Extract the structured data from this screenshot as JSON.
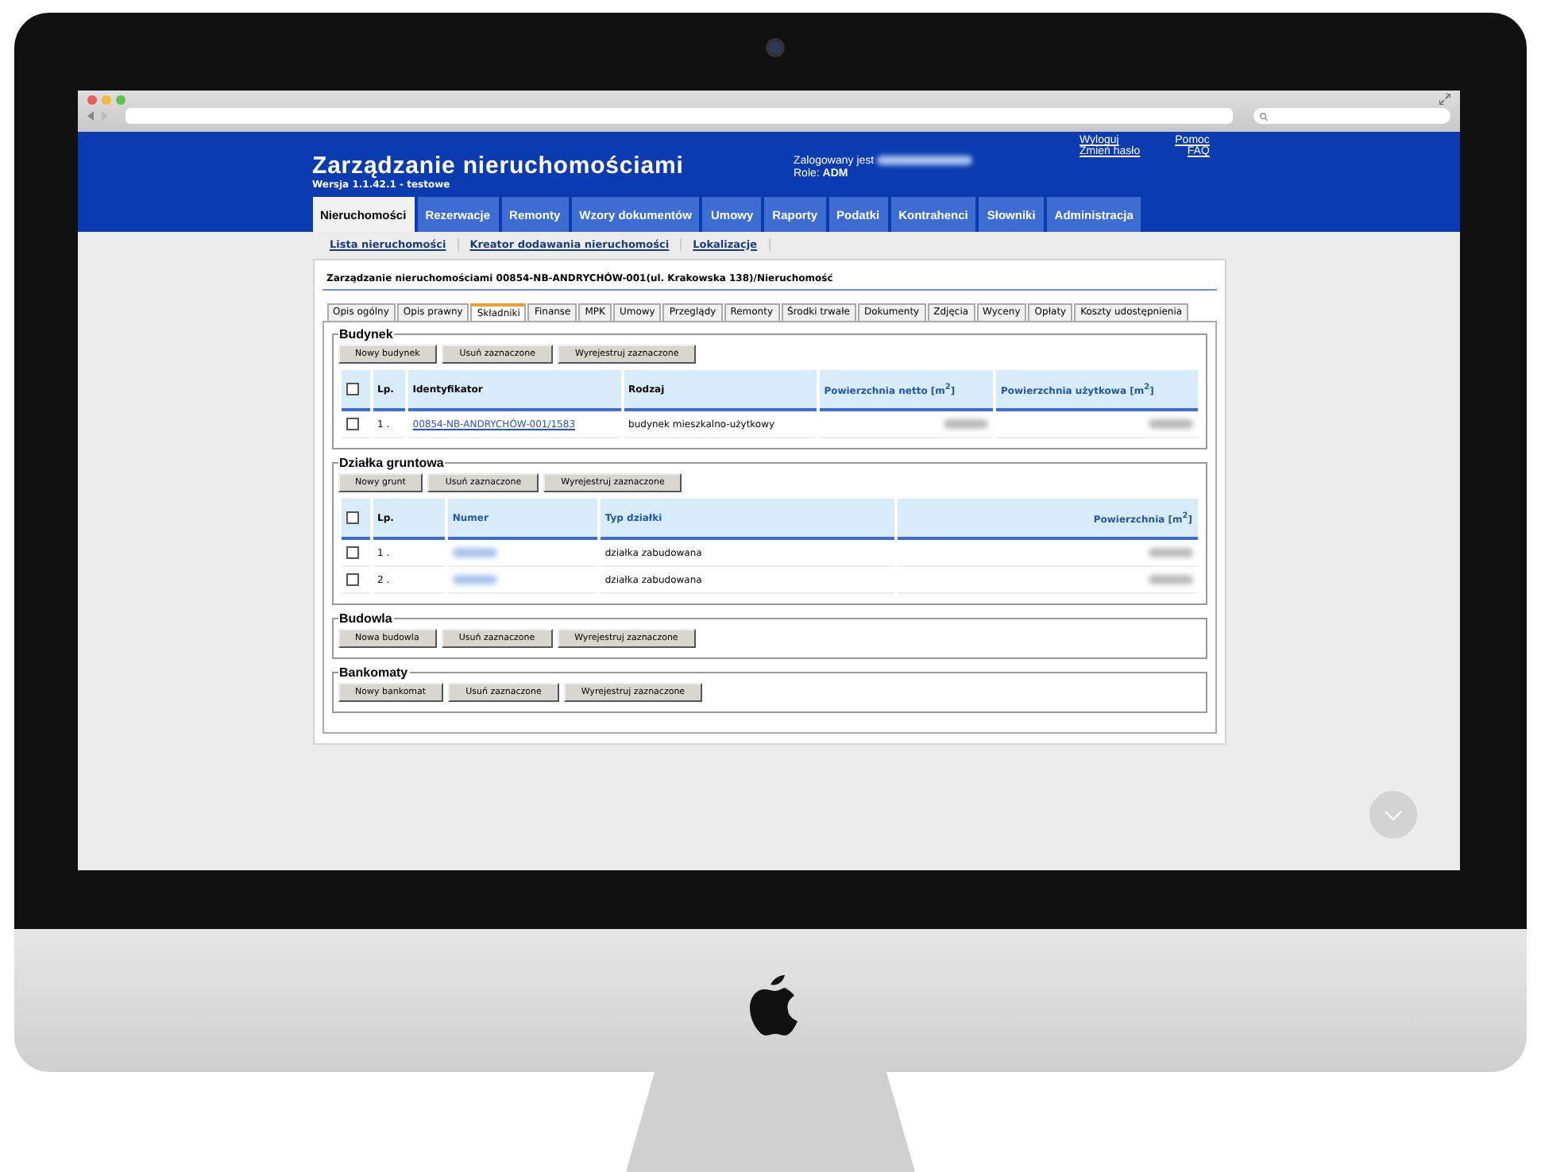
{
  "header": {
    "title": "Zarządzanie nieruchomościami",
    "version": "Wersja 1.1.42.1 - testowe",
    "user_label": "Zalogowany jest",
    "role_label": "Role:",
    "role": "ADM",
    "links": [
      "Wyloguj",
      "Pomoc",
      "Zmień hasło",
      "FAQ"
    ]
  },
  "nav_tabs": [
    {
      "label": "Nieruchomości",
      "selected": true
    },
    {
      "label": "Rezerwacje",
      "selected": false
    },
    {
      "label": "Remonty",
      "selected": false
    },
    {
      "label": "Wzory dokumentów",
      "selected": false
    },
    {
      "label": "Umowy",
      "selected": false
    },
    {
      "label": "Raporty",
      "selected": false
    },
    {
      "label": "Podatki",
      "selected": false
    },
    {
      "label": "Kontrahenci",
      "selected": false
    },
    {
      "label": "Słowniki",
      "selected": false
    },
    {
      "label": "Administracja",
      "selected": false
    }
  ],
  "subnav": [
    "Lista nieruchomości",
    "Kreator dodawania nieruchomości",
    "Lokalizacje"
  ],
  "breadcrumb": "Zarządzanie nieruchomościami 00854-NB-ANDRYCHÓW-001(ul. Krakowska 138)/Nieruchomość",
  "detail_tabs": [
    {
      "label": "Opis ogólny",
      "selected": false
    },
    {
      "label": "Opis prawny",
      "selected": false
    },
    {
      "label": "Składniki",
      "selected": true
    },
    {
      "label": "Finanse",
      "selected": false
    },
    {
      "label": "MPK",
      "selected": false
    },
    {
      "label": "Umowy",
      "selected": false
    },
    {
      "label": "Przeglądy",
      "selected": false
    },
    {
      "label": "Remonty",
      "selected": false
    },
    {
      "label": "Środki trwałe",
      "selected": false
    },
    {
      "label": "Dokumenty",
      "selected": false
    },
    {
      "label": "Zdjęcia",
      "selected": false
    },
    {
      "label": "Wyceny",
      "selected": false
    },
    {
      "label": "Opłaty",
      "selected": false
    },
    {
      "label": "Koszty udostępnienia",
      "selected": false
    }
  ],
  "sections": [
    {
      "title": "Budynek",
      "buttons": [
        "Nowy budynek",
        "Usuń zaznaczone",
        "Wyrejestruj zaznaczone"
      ],
      "table": {
        "header_checked": false,
        "columns": [
          {
            "label": "Lp.",
            "sortable": false,
            "right_aligned": false
          },
          {
            "label": "Identyfikator",
            "sortable": false,
            "right_aligned": false
          },
          {
            "label": "Rodzaj",
            "sortable": false,
            "right_aligned": false
          },
          {
            "label": "Powierzchnia netto [m$^{2}$]",
            "sortable": true,
            "right_aligned": false
          },
          {
            "label": "Powierzchnia użytkowa [m$^{2}$]",
            "sortable": true,
            "right_aligned": false
          }
        ],
        "rows": [
          {
            "checked": false,
            "cells": [
              {
                "kind": "text",
                "text": "1 ."
              },
              {
                "kind": "link",
                "text": "00854-NB-ANDRYCHÓW-001/1583"
              },
              {
                "kind": "text",
                "text": "budynek mieszkalno-użytkowy"
              },
              {
                "kind": "redacted"
              },
              {
                "kind": "redacted"
              }
            ]
          }
        ]
      }
    },
    {
      "title": "Działka gruntowa",
      "buttons": [
        "Nowy grunt",
        "Usuń zaznaczone",
        "Wyrejestruj zaznaczone"
      ],
      "table": {
        "header_checked": false,
        "columns": [
          {
            "label": "Lp.",
            "sortable": false,
            "right_aligned": false
          },
          {
            "label": "Numer",
            "sortable": true,
            "right_aligned": false
          },
          {
            "label": "Typ działki",
            "sortable": true,
            "right_aligned": false
          },
          {
            "label": "Powierzchnia [m$^{2}$]",
            "sortable": true,
            "right_aligned": true
          }
        ],
        "rows": [
          {
            "checked": false,
            "cells": [
              {
                "kind": "text",
                "text": "1 ."
              },
              {
                "kind": "redacted_link"
              },
              {
                "kind": "text",
                "text": "działka zabudowana"
              },
              {
                "kind": "redacted"
              }
            ]
          },
          {
            "checked": false,
            "cells": [
              {
                "kind": "text",
                "text": "2 ."
              },
              {
                "kind": "redacted_link"
              },
              {
                "kind": "text",
                "text": "działka zabudowana"
              },
              {
                "kind": "redacted"
              }
            ]
          }
        ]
      }
    },
    {
      "title": "Budowla",
      "buttons": [
        "Nowa budowla",
        "Usuń zaznaczone",
        "Wyrejestruj zaznaczone"
      ]
    },
    {
      "title": "Bankomaty",
      "buttons": [
        "Nowy bankomat",
        "Usuń zaznaczone",
        "Wyrejestruj zaznaczone"
      ]
    }
  ]
}
